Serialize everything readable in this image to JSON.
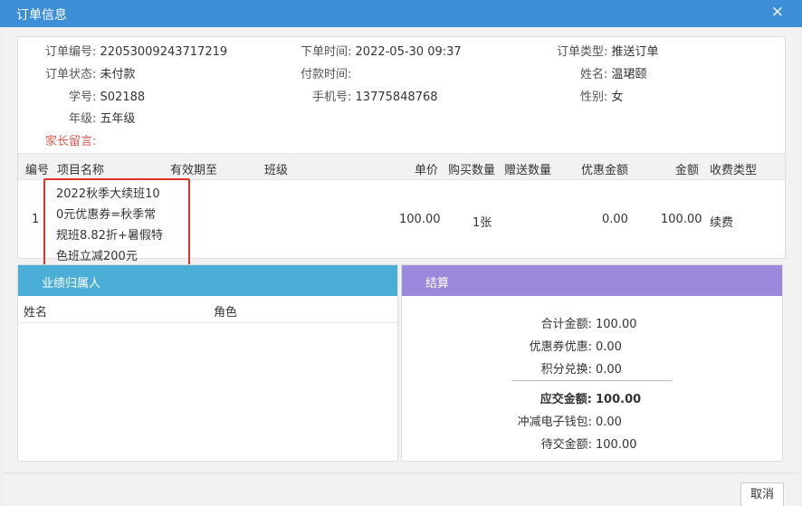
{
  "window": {
    "title": "订单信息",
    "close_symbol": "×"
  },
  "order": {
    "order_no_label": "订单编号:",
    "order_no": "220530092437172​19",
    "order_time_label": "下单时间:",
    "order_time": "2022-05-30 09:37",
    "order_type_label": "订单类型:",
    "order_type": "推送订单",
    "status_label": "订单状态:",
    "status": "未付款",
    "pay_time_label": "付款时间:",
    "pay_time": "",
    "name_label": "姓名:",
    "name": "温珺颐",
    "student_id_label": "学号:",
    "student_id": "S02188",
    "phone_label": "手机号:",
    "phone": "13775848768",
    "gender_label": "性别:",
    "gender": "女",
    "grade_label": "年级:",
    "grade": "五年级",
    "parent_note_label": "家长留言:"
  },
  "items_table": {
    "headers": [
      "编号",
      "项目名称",
      "有效期至",
      "班级",
      "单价",
      "购买数量",
      "赠送数量",
      "优惠金额",
      "金额",
      "收费类型"
    ],
    "rows": [
      {
        "no": "1",
        "name_lines": [
          "2022秋季大续班10",
          "0元优惠券=秋季常",
          "规班8.82折+暑假特",
          "色班立减200元"
        ],
        "valid_until": "",
        "class": "",
        "unit_price": "100.00",
        "quantity": "1张",
        "gift_quantity": "",
        "discount": "0.00",
        "amount": "100.00",
        "fee_type": "续费"
      }
    ]
  },
  "performance": {
    "title": "业绩归属人",
    "col_name": "姓名",
    "col_role": "角色"
  },
  "settlement": {
    "title": "结算",
    "total_label": "合计金额:",
    "total": "100.00",
    "coupon_label": "优惠券优惠:",
    "coupon": "0.00",
    "points_label": "积分兑换:",
    "points": "0.00",
    "payable_label": "应交金额:",
    "payable": "100.00",
    "wallet_label": "冲减电子钱包:",
    "wallet": "0.00",
    "pending_label": "待交金额:",
    "pending": "100.00"
  },
  "footer": {
    "cancel_label": "取消"
  },
  "colors": {
    "titlebar": "#3c8fd6",
    "perf_header": "#4baed7",
    "settle_header": "#9b89dc",
    "note_red": "#e05a4f",
    "highlight_box": "#e5302a"
  }
}
